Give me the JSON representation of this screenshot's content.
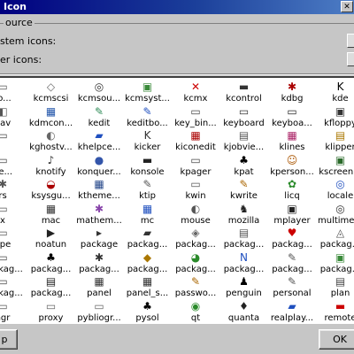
{
  "window": {
    "title": "Icon",
    "close_glyph": "✕"
  },
  "source": {
    "group_label": "ource",
    "system_label": "stem icons:",
    "user_label": "er icons:"
  },
  "icon_grid": {
    "rows": [
      [
        {
          "l": "ro...",
          "i": "▭",
          "c": "#555"
        },
        {
          "l": "kcmscsi",
          "i": "◇",
          "c": "#666"
        },
        {
          "l": "kcmsou...",
          "i": "◎",
          "c": "#333"
        },
        {
          "l": "kcmsyst...",
          "i": "▣",
          "c": "#3a8a3a"
        },
        {
          "l": "kcmx",
          "i": "✕",
          "c": "#cc0000"
        },
        {
          "l": "kcontrol",
          "i": "▬",
          "c": "#333"
        },
        {
          "l": "kdbg",
          "i": "✱",
          "c": "#aa0000"
        },
        {
          "l": "kde",
          "i": "K",
          "c": "#000"
        }
      ],
      [
        {
          "l": "nav",
          "i": "◧",
          "c": "#555"
        },
        {
          "l": "kdmcon...",
          "i": "▦",
          "c": "#2255aa"
        },
        {
          "l": "kedit",
          "i": "✎",
          "c": "#2e8b57"
        },
        {
          "l": "keditbo...",
          "i": "✎",
          "c": "#1f4fbf"
        },
        {
          "l": "key_bin...",
          "i": "▭",
          "c": "#444"
        },
        {
          "l": "keyboard",
          "i": "▭",
          "c": "#333"
        },
        {
          "l": "keyboa...",
          "i": "▭",
          "c": "#222"
        },
        {
          "l": "kfloppy",
          "i": "▣",
          "c": "#333"
        }
      ],
      [
        {
          "l": "",
          "i": "▭",
          "c": "#444"
        },
        {
          "l": "kghostv...",
          "i": "◐",
          "c": "#666"
        },
        {
          "l": "khelpce...",
          "i": "▰",
          "c": "#1f4fbf"
        },
        {
          "l": "kicker",
          "i": "K",
          "c": "#333"
        },
        {
          "l": "kiconedit",
          "i": "▦",
          "c": "#aa0000"
        },
        {
          "l": "kjobvie...",
          "i": "▤",
          "c": "#555"
        },
        {
          "l": "klines",
          "i": "▦",
          "c": "#aa2266"
        },
        {
          "l": "klipper",
          "i": "▤",
          "c": "#aa7700"
        }
      ],
      [
        {
          "l": "ue...",
          "i": "▭",
          "c": "#444"
        },
        {
          "l": "knotify",
          "i": "♪",
          "c": "#333"
        },
        {
          "l": "konquer...",
          "i": "●",
          "c": "#3355aa"
        },
        {
          "l": "konsole",
          "i": "▬",
          "c": "#222"
        },
        {
          "l": "kpager",
          "i": "▭",
          "c": "#444"
        },
        {
          "l": "kpat",
          "i": "♣",
          "c": "#000"
        },
        {
          "l": "kperson...",
          "i": "☺",
          "c": "#aa5500"
        },
        {
          "l": "kscreen...",
          "i": "▣",
          "c": "#2a6a2a"
        }
      ],
      [
        {
          "l": "rs",
          "i": "✱",
          "c": "#555"
        },
        {
          "l": "ksysgu...",
          "i": "◒",
          "c": "#aa0000"
        },
        {
          "l": "ktheme...",
          "i": "▦",
          "c": "#224488"
        },
        {
          "l": "ktip",
          "i": "✎",
          "c": "#555"
        },
        {
          "l": "kwin",
          "i": "▭",
          "c": "#555"
        },
        {
          "l": "kwrite",
          "i": "✎",
          "c": "#aa6600"
        },
        {
          "l": "licq",
          "i": "✿",
          "c": "#2a8a2a"
        },
        {
          "l": "locale",
          "i": "◎",
          "c": "#1f4fbf"
        }
      ],
      [
        {
          "l": "x",
          "i": "▭",
          "c": "#555"
        },
        {
          "l": "mac",
          "i": "▦",
          "c": "#333"
        },
        {
          "l": "mathem...",
          "i": "✱",
          "c": "#8844aa"
        },
        {
          "l": "mc",
          "i": "▦",
          "c": "#1f4fbf"
        },
        {
          "l": "mouse",
          "i": "◐",
          "c": "#555"
        },
        {
          "l": "mozilla",
          "i": "♞",
          "c": "#222"
        },
        {
          "l": "mplayer",
          "i": "▣",
          "c": "#222"
        },
        {
          "l": "multime...",
          "i": "◎",
          "c": "#333"
        }
      ],
      [
        {
          "l": "ape",
          "i": "▭",
          "c": "#555"
        },
        {
          "l": "noatun",
          "i": "▶",
          "c": "#222"
        },
        {
          "l": "package",
          "i": "▸",
          "c": "#333"
        },
        {
          "l": "packag...",
          "i": "▰",
          "c": "#333"
        },
        {
          "l": "packag...",
          "i": "◈",
          "c": "#666"
        },
        {
          "l": "packag...",
          "i": "▤",
          "c": "#555"
        },
        {
          "l": "packag...",
          "i": "♥",
          "c": "#cc0000"
        },
        {
          "l": "packag...",
          "i": "◬",
          "c": "#555"
        }
      ],
      [
        {
          "l": "packag...",
          "i": "▭",
          "c": "#444"
        },
        {
          "l": "packag...",
          "i": "♣",
          "c": "#000"
        },
        {
          "l": "packag...",
          "i": "✱",
          "c": "#333"
        },
        {
          "l": "packag...",
          "i": "◆",
          "c": "#aa7700"
        },
        {
          "l": "packag...",
          "i": "◕",
          "c": "#2a8a2a"
        },
        {
          "l": "packag...",
          "i": "N",
          "c": "#1f4fbf"
        },
        {
          "l": "packag...",
          "i": "✎",
          "c": "#555"
        },
        {
          "l": "packag...",
          "i": "▣",
          "c": "#3a8a3a"
        }
      ],
      [
        {
          "l": "packag...",
          "i": "▭",
          "c": "#444"
        },
        {
          "l": "packag...",
          "i": "▤",
          "c": "#222"
        },
        {
          "l": "panel",
          "i": "▦",
          "c": "#333"
        },
        {
          "l": "panel_s...",
          "i": "▦",
          "c": "#333"
        },
        {
          "l": "passwo...",
          "i": "✎",
          "c": "#aa6600"
        },
        {
          "l": "penguin",
          "i": "♟",
          "c": "#000"
        },
        {
          "l": "personal",
          "i": "✎",
          "c": "#555"
        },
        {
          "l": "plan",
          "i": "▤",
          "c": "#444"
        }
      ],
      [
        {
          "l": "ngr",
          "i": "▭",
          "c": "#555"
        },
        {
          "l": "proxy",
          "i": "▭",
          "c": "#666"
        },
        {
          "l": "pybliogr...",
          "i": "▭",
          "c": "#666"
        },
        {
          "l": "pysol",
          "i": "♣",
          "c": "#000"
        },
        {
          "l": "qt",
          "i": "◉",
          "c": "#2a8a2a"
        },
        {
          "l": "quanta",
          "i": "♦",
          "c": "#222"
        },
        {
          "l": "realplay...",
          "i": "▰",
          "c": "#1f4fbf"
        },
        {
          "l": "remote",
          "i": "▬",
          "c": "#cc0000"
        }
      ]
    ]
  },
  "buttons": {
    "left": "p",
    "ok": "OK"
  }
}
